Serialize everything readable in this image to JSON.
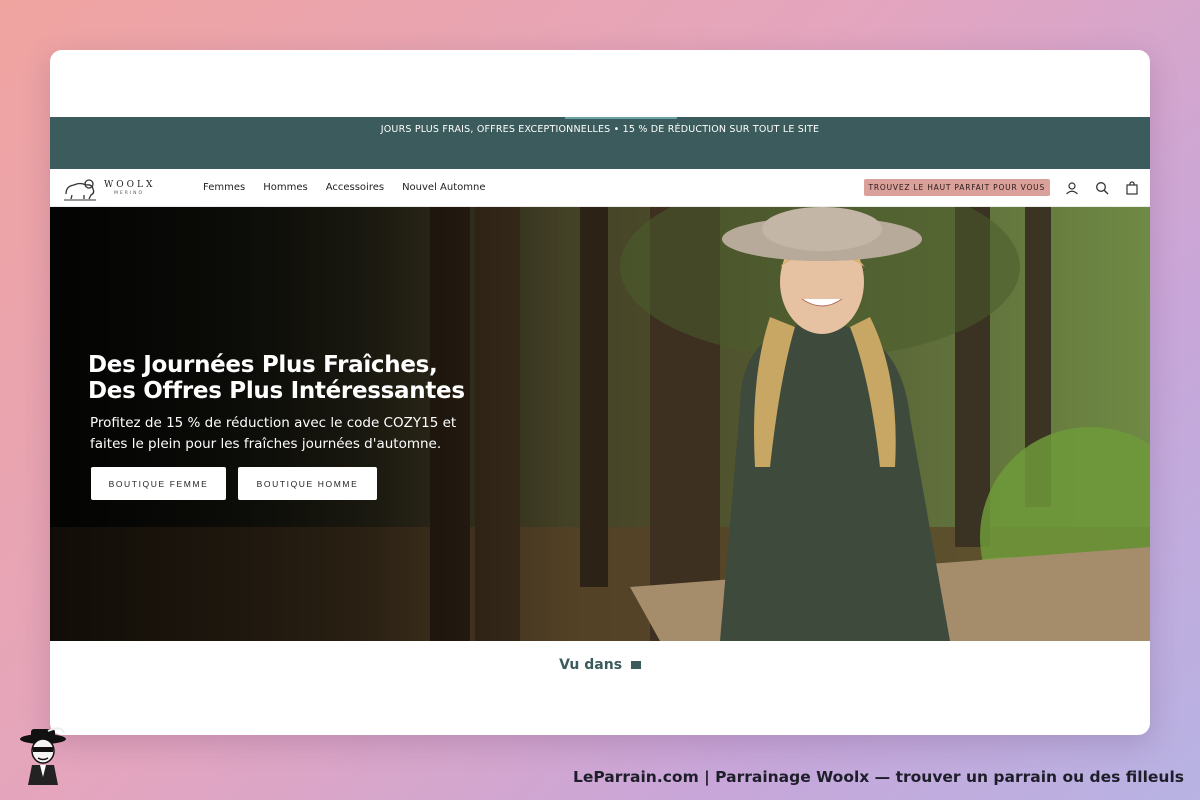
{
  "announcement": {
    "text": "JOURS PLUS FRAIS, OFFRES EXCEPTIONNELLES • 15 % DE RÉDUCTION SUR TOUT LE SITE"
  },
  "header": {
    "logo_word": "WOOLX",
    "logo_sub": "MERINO",
    "nav": [
      "Femmes",
      "Hommes",
      "Accessoires",
      "Nouvel Automne"
    ],
    "fit_button": "TROUVEZ LE HAUT PARFAIT POUR VOUS",
    "icons": [
      "account-icon",
      "search-icon",
      "cart-icon"
    ]
  },
  "hero": {
    "title_line1": "Des Journées Plus Fraîches,",
    "title_line2": "Des Offres Plus Intéressantes",
    "subtitle_line1": "Profitez de 15 % de réduction avec le code COZY15 et",
    "subtitle_line2": "faites le plein pour les fraîches journées d'automne.",
    "button_women": "BOUTIQUE FEMME",
    "button_men": "BOUTIQUE HOMME"
  },
  "seen_in": "Vu dans",
  "footer": {
    "text": "LeParrain.com | Parrainage Woolx — trouver un parrain ou des filleuls"
  },
  "colors": {
    "announcement_bg": "#3b5b5c",
    "fit_button_bg": "#d9a19a",
    "accent_text": "#3b5b5c"
  }
}
